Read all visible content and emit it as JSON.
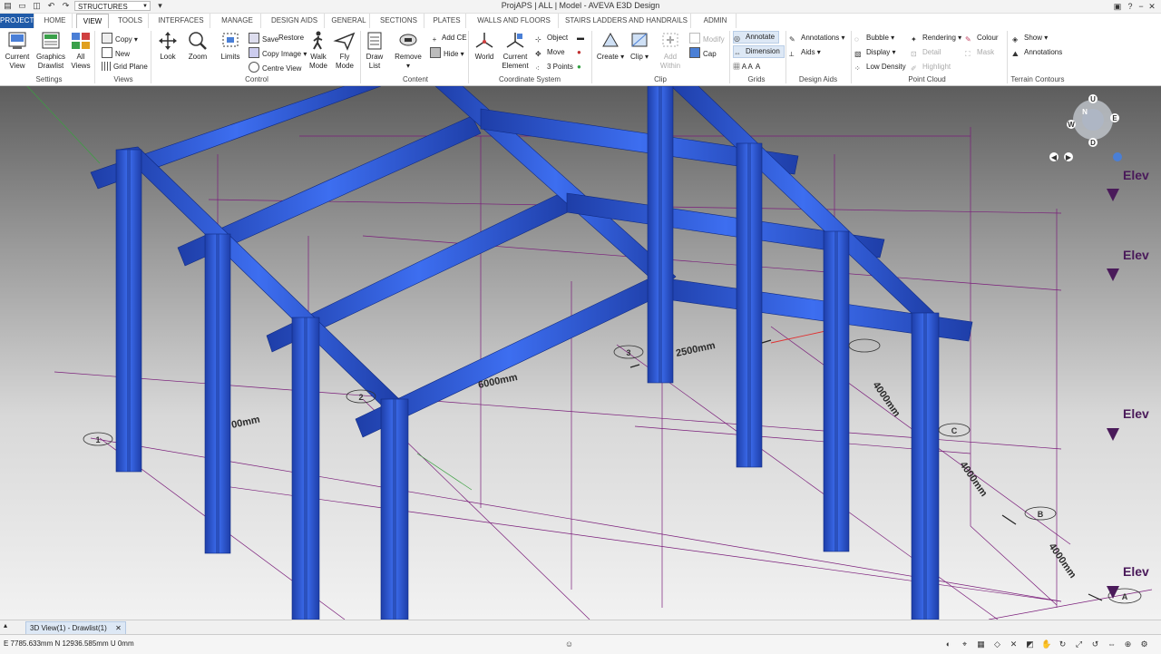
{
  "window": {
    "title": "ProjAPS | ALL | Model - AVEVA E3D Design",
    "module_combo": "STRUCTURES",
    "controls": [
      "minimize-icon",
      "restore-icon",
      "close-icon"
    ]
  },
  "tabs": [
    "PROJECT",
    "HOME",
    "VIEW",
    "TOOLS",
    "INTERFACES",
    "MANAGE",
    "DESIGN AIDS",
    "GENERAL",
    "SECTIONS",
    "PLATES",
    "WALLS AND FLOORS",
    "STAIRS LADDERS AND HANDRAILS",
    "ADMIN"
  ],
  "active_tab": "VIEW",
  "ribbon": {
    "settings": {
      "label": "Settings",
      "current_view": "Current\nView",
      "graphics_drawlist": "Graphics\nDrawlist"
    },
    "views": {
      "label": "Views",
      "all_views": "All\nViews",
      "copy": "Copy",
      "new": "New",
      "grid_plane": "Grid Plane"
    },
    "control": {
      "label": "Control",
      "look": "Look",
      "zoom": "Zoom",
      "limits": "Limits",
      "save": "Save",
      "restore": "Restore",
      "copy_image": "Copy Image",
      "centre_view": "Centre View",
      "walk_mode": "Walk\nMode",
      "fly_mode": "Fly\nMode"
    },
    "content": {
      "label": "Content",
      "draw_list": "Draw\nList",
      "remove": "Remove",
      "add_ce": "Add CE",
      "hide": "Hide"
    },
    "coordinate_system": {
      "label": "Coordinate System",
      "world": "World",
      "current_element": "Current\nElement",
      "object": "Object",
      "move": "Move",
      "three_points": "3 Points"
    },
    "clip": {
      "label": "Clip",
      "create": "Create",
      "clip": "Clip",
      "add_within": "Add\nWithin",
      "modify": "Modify",
      "cap": "Cap"
    },
    "grids": {
      "label": "Grids",
      "annotate": "Annotate",
      "dimension": "Dimension"
    },
    "design_aids": {
      "label": "Design Aids",
      "annotations": "Annotations",
      "aids": "Aids"
    },
    "point_cloud": {
      "label": "Point Cloud",
      "bubble": "Bubble",
      "display": "Display",
      "low_density": "Low Density",
      "rendering": "Rendering",
      "colour": "Colour",
      "detail": "Detail",
      "mask": "Mask",
      "highlight": "Highlight"
    },
    "terrain_contours": {
      "label": "Terrain Contours",
      "show": "Show",
      "annotations": "Annotations"
    }
  },
  "viewport": {
    "gridline_labels": [
      "1",
      "2",
      "3",
      "A",
      "B",
      "C"
    ],
    "dimensions": [
      "6000mm",
      "2500mm",
      "4000mm",
      "4000mm",
      "4000mm",
      "00mm"
    ],
    "elevation_label": "Elev",
    "navcube": {
      "up": "U",
      "down": "D",
      "west": "W",
      "east": "E",
      "north": "N"
    },
    "colors": {
      "steel": "#2f5ed8",
      "grid": "#7a1d7a",
      "background_top": "#5d5d5d",
      "background_bottom": "#f2f2f2"
    }
  },
  "doc_tab": {
    "label": "3D View(1) - Drawlist(1)"
  },
  "status": {
    "coordinates": "E 7785.633mm N 12936.585mm U 0mm"
  }
}
